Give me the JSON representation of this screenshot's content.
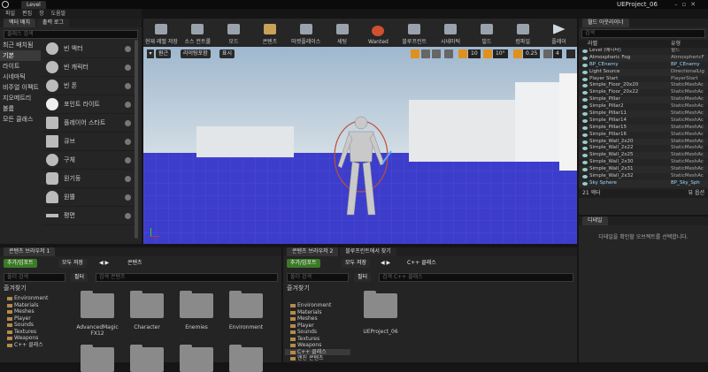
{
  "window": {
    "tab": "Level",
    "project": "UEProject_06"
  },
  "menu": [
    "파일",
    "편집",
    "창",
    "도움말"
  ],
  "place": {
    "title": "액터 배치",
    "output_tab": "출력 로그",
    "search_placeholder": "클래스 검색",
    "categories": [
      "최근 배치됨",
      "기본",
      "라이트",
      "시네마틱",
      "비주얼 이펙트",
      "지오메트리",
      "볼륨",
      "모든 클래스"
    ],
    "items": [
      "빈 액터",
      "빈 캐릭터",
      "빈 폰",
      "포인트 라이트",
      "플레이어 스타트",
      "큐브",
      "구체",
      "원기둥",
      "원뿔",
      "평면"
    ]
  },
  "toolbar": [
    "현재 레벨 저장",
    "소스 컨트롤",
    "모드",
    "콘텐츠",
    "마켓플레이스",
    "세팅",
    "Wanted",
    "블루프린트",
    "시네마틱",
    "빌드",
    "컴파일",
    "플레이"
  ],
  "viewport": {
    "perspective": "원근",
    "lit": "라이팅포함",
    "show": "표시",
    "grid": "10",
    "angle": "10°",
    "scale": "0.25",
    "speed": "4"
  },
  "outliner": {
    "title": "월드 아웃라이너",
    "search_placeholder": "검색",
    "col_label": "라벨",
    "col_type": "유형",
    "rows": [
      {
        "name": "Level (에디터)",
        "type": "월드",
        "blue": false
      },
      {
        "name": "Atmospheric Fog",
        "type": "AtmosphericF",
        "blue": false
      },
      {
        "name": "BP_CEnemy",
        "type": "BP_CEnemy",
        "blue": true
      },
      {
        "name": "Light Source",
        "type": "DirectionalLig",
        "blue": false
      },
      {
        "name": "Player Start",
        "type": "PlayerStart",
        "blue": false
      },
      {
        "name": "Simple_Floor_20x20",
        "type": "StaticMeshAc",
        "blue": false
      },
      {
        "name": "Simple_Floor_20x22",
        "type": "StaticMeshAc",
        "blue": false
      },
      {
        "name": "Simple_Pillar",
        "type": "StaticMeshAc",
        "blue": false
      },
      {
        "name": "Simple_Pillar2",
        "type": "StaticMeshAc",
        "blue": false
      },
      {
        "name": "Simple_Pillar11",
        "type": "StaticMeshAc",
        "blue": false
      },
      {
        "name": "Simple_Pillar14",
        "type": "StaticMeshAc",
        "blue": false
      },
      {
        "name": "Simple_Pillar15",
        "type": "StaticMeshAc",
        "blue": false
      },
      {
        "name": "Simple_Pillar16",
        "type": "StaticMeshAc",
        "blue": false
      },
      {
        "name": "Simple_Wall_2x20",
        "type": "StaticMeshAc",
        "blue": false
      },
      {
        "name": "Simple_Wall_2x22",
        "type": "StaticMeshAc",
        "blue": false
      },
      {
        "name": "Simple_Wall_2x25",
        "type": "StaticMeshAc",
        "blue": false
      },
      {
        "name": "Simple_Wall_2x30",
        "type": "StaticMeshAc",
        "blue": false
      },
      {
        "name": "Simple_Wall_2x31",
        "type": "StaticMeshAc",
        "blue": false
      },
      {
        "name": "Simple_Wall_2x32",
        "type": "StaticMeshAc",
        "blue": false
      },
      {
        "name": "Sky Sphere",
        "type": "BP_Sky_Sph",
        "blue": true
      }
    ],
    "count": "21 액터",
    "view_options": "뷰 옵션"
  },
  "details": {
    "title": "디테일",
    "hint": "디테일을 확인할 오브젝트를 선택합니다."
  },
  "cb1": {
    "tab": "콘텐츠 브라우저 1",
    "add": "추가/임포트",
    "save": "모두 저장",
    "path": "콘텐츠",
    "filter": "필터",
    "search": "검색 콘텐츠",
    "tree_search": "폴더 검색",
    "favorites": "즐겨찾기",
    "tree": [
      "Environment",
      "Materials",
      "Meshes",
      "Player",
      "Sounds",
      "Textures",
      "Weapons"
    ],
    "cpp": "C++ 클래스",
    "folders": [
      "AdvancedMagic FX12",
      "Character",
      "Enemies",
      "Environment"
    ]
  },
  "cb2": {
    "tab": "콘텐츠 브라우저 2",
    "tab2": "블루프린트에서 찾기",
    "add": "추가/임포트",
    "save": "모두 저장",
    "path": "C++ 클래스",
    "filter": "필터",
    "search": "검색 C++ 클래스",
    "tree_search": "폴더 검색",
    "favorites": "즐겨찾기",
    "tree": [
      "Environment",
      "Materials",
      "Meshes",
      "Player",
      "Sounds",
      "Textures",
      "Weapons"
    ],
    "cpp": "C++ 클래스",
    "more": "엔진 콘텐츠",
    "folders": [
      "UEProject_06"
    ]
  }
}
